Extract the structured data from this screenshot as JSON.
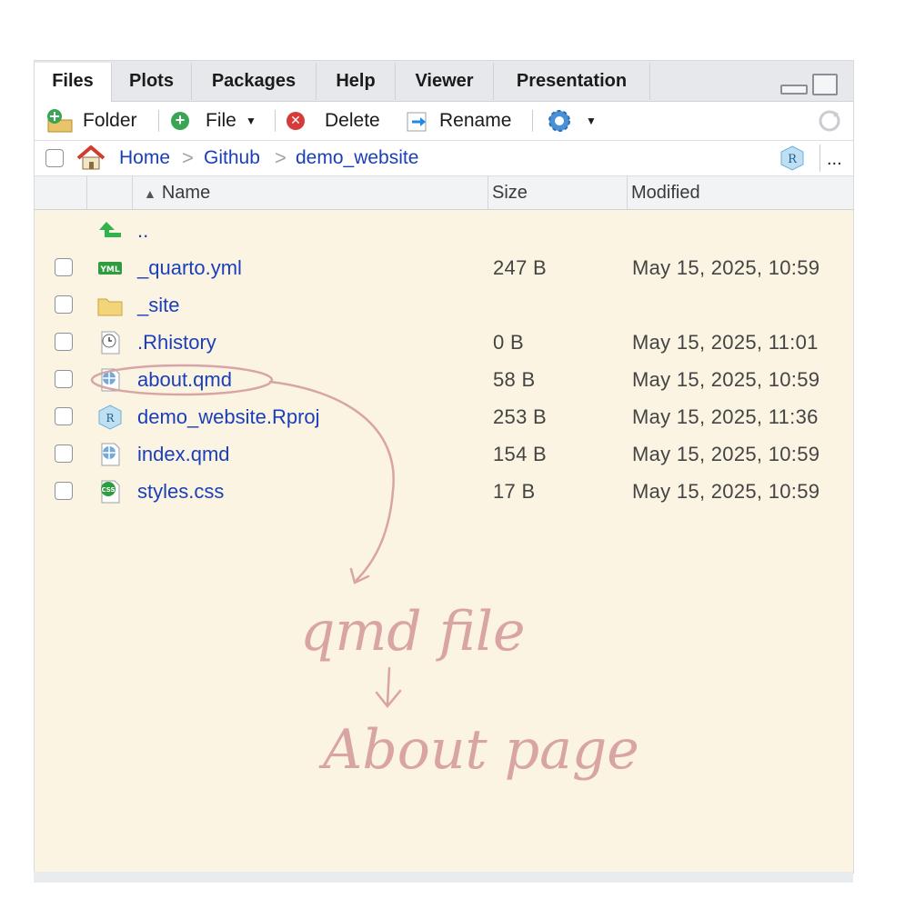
{
  "tabs": [
    {
      "label": "Files",
      "active": true
    },
    {
      "label": "Plots",
      "active": false
    },
    {
      "label": "Packages",
      "active": false
    },
    {
      "label": "Help",
      "active": false
    },
    {
      "label": "Viewer",
      "active": false
    },
    {
      "label": "Presentation",
      "active": false
    }
  ],
  "toolbar": {
    "new_folder": "Folder",
    "new_file": "File",
    "delete": "Delete",
    "rename": "Rename"
  },
  "breadcrumb": {
    "home": "Home",
    "github": "Github",
    "current": "demo_website",
    "separator": ">",
    "more": "..."
  },
  "columns": {
    "name": "Name",
    "size": "Size",
    "modified": "Modified"
  },
  "files": [
    {
      "name": "..",
      "size": "",
      "modified": "",
      "icon": "up-arrow-icon"
    },
    {
      "name": "_quarto.yml",
      "size": "247 B",
      "modified": "May 15, 2025, 10:59",
      "icon": "yml-file-icon"
    },
    {
      "name": "_site",
      "size": "",
      "modified": "",
      "icon": "folder-icon"
    },
    {
      "name": ".Rhistory",
      "size": "0 B",
      "modified": "May 15, 2025, 11:01",
      "icon": "history-file-icon"
    },
    {
      "name": "about.qmd",
      "size": "58 B",
      "modified": "May 15, 2025, 10:59",
      "icon": "quarto-file-icon"
    },
    {
      "name": "demo_website.Rproj",
      "size": "253 B",
      "modified": "May 15, 2025, 11:36",
      "icon": "rproj-file-icon"
    },
    {
      "name": "index.qmd",
      "size": "154 B",
      "modified": "May 15, 2025, 10:59",
      "icon": "quarto-file-icon"
    },
    {
      "name": "styles.css",
      "size": "17 B",
      "modified": "May 15, 2025, 10:59",
      "icon": "css-file-icon"
    }
  ],
  "annotation": {
    "line1": "qmd file",
    "line2": "About page",
    "color": "#d9a4a4"
  },
  "colors": {
    "link": "#1a3fb8",
    "pane_background": "#fcf4e3"
  }
}
